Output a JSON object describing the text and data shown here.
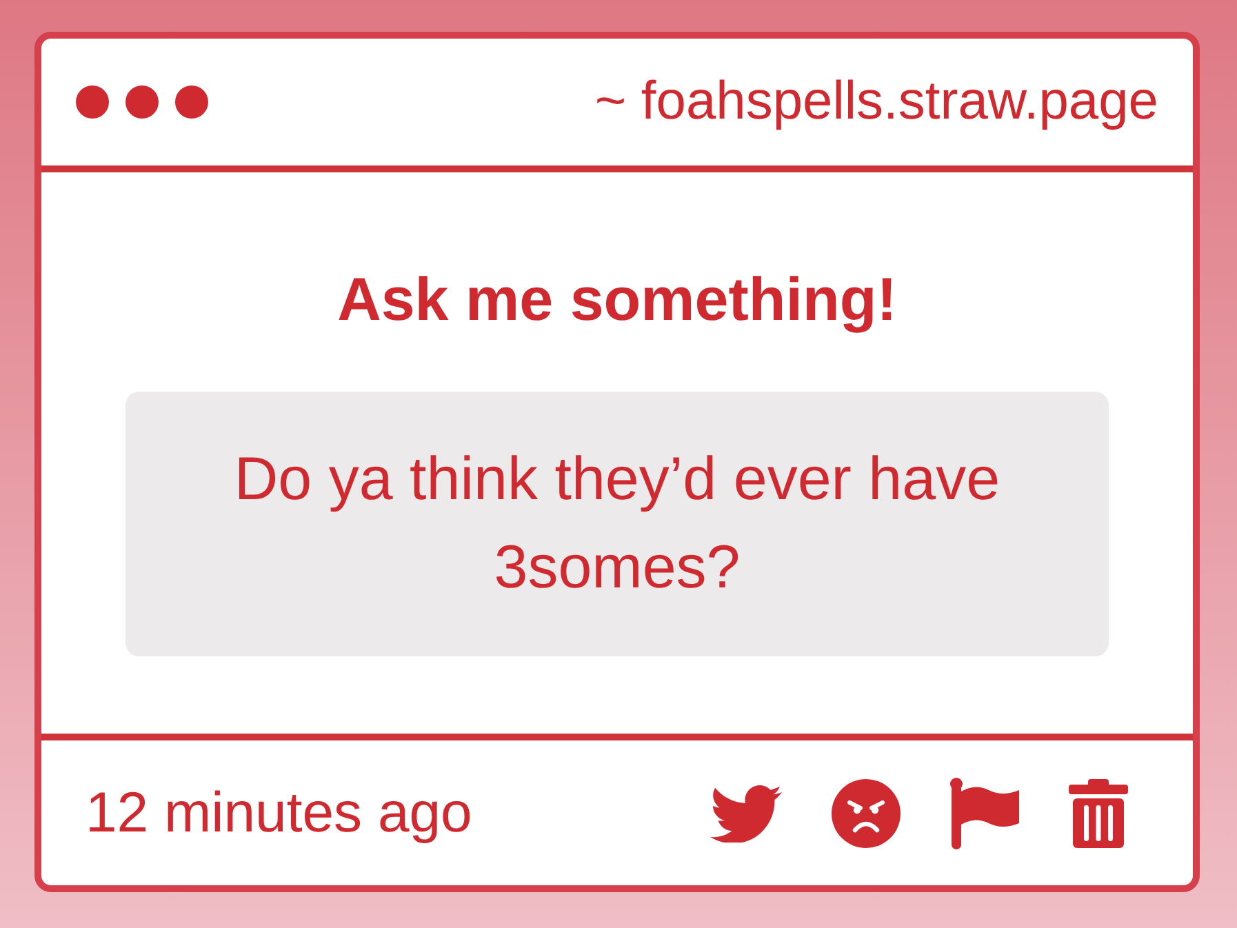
{
  "address_bar": {
    "url": "~ foahspells.straw.page"
  },
  "prompt": {
    "title": "Ask me something!"
  },
  "question": {
    "text": "Do ya think they’d ever have 3somes?"
  },
  "footer": {
    "time": "12 minutes ago",
    "actions": [
      {
        "kind": "tweet"
      },
      {
        "kind": "angry"
      },
      {
        "kind": "flag"
      },
      {
        "kind": "delete"
      }
    ]
  }
}
